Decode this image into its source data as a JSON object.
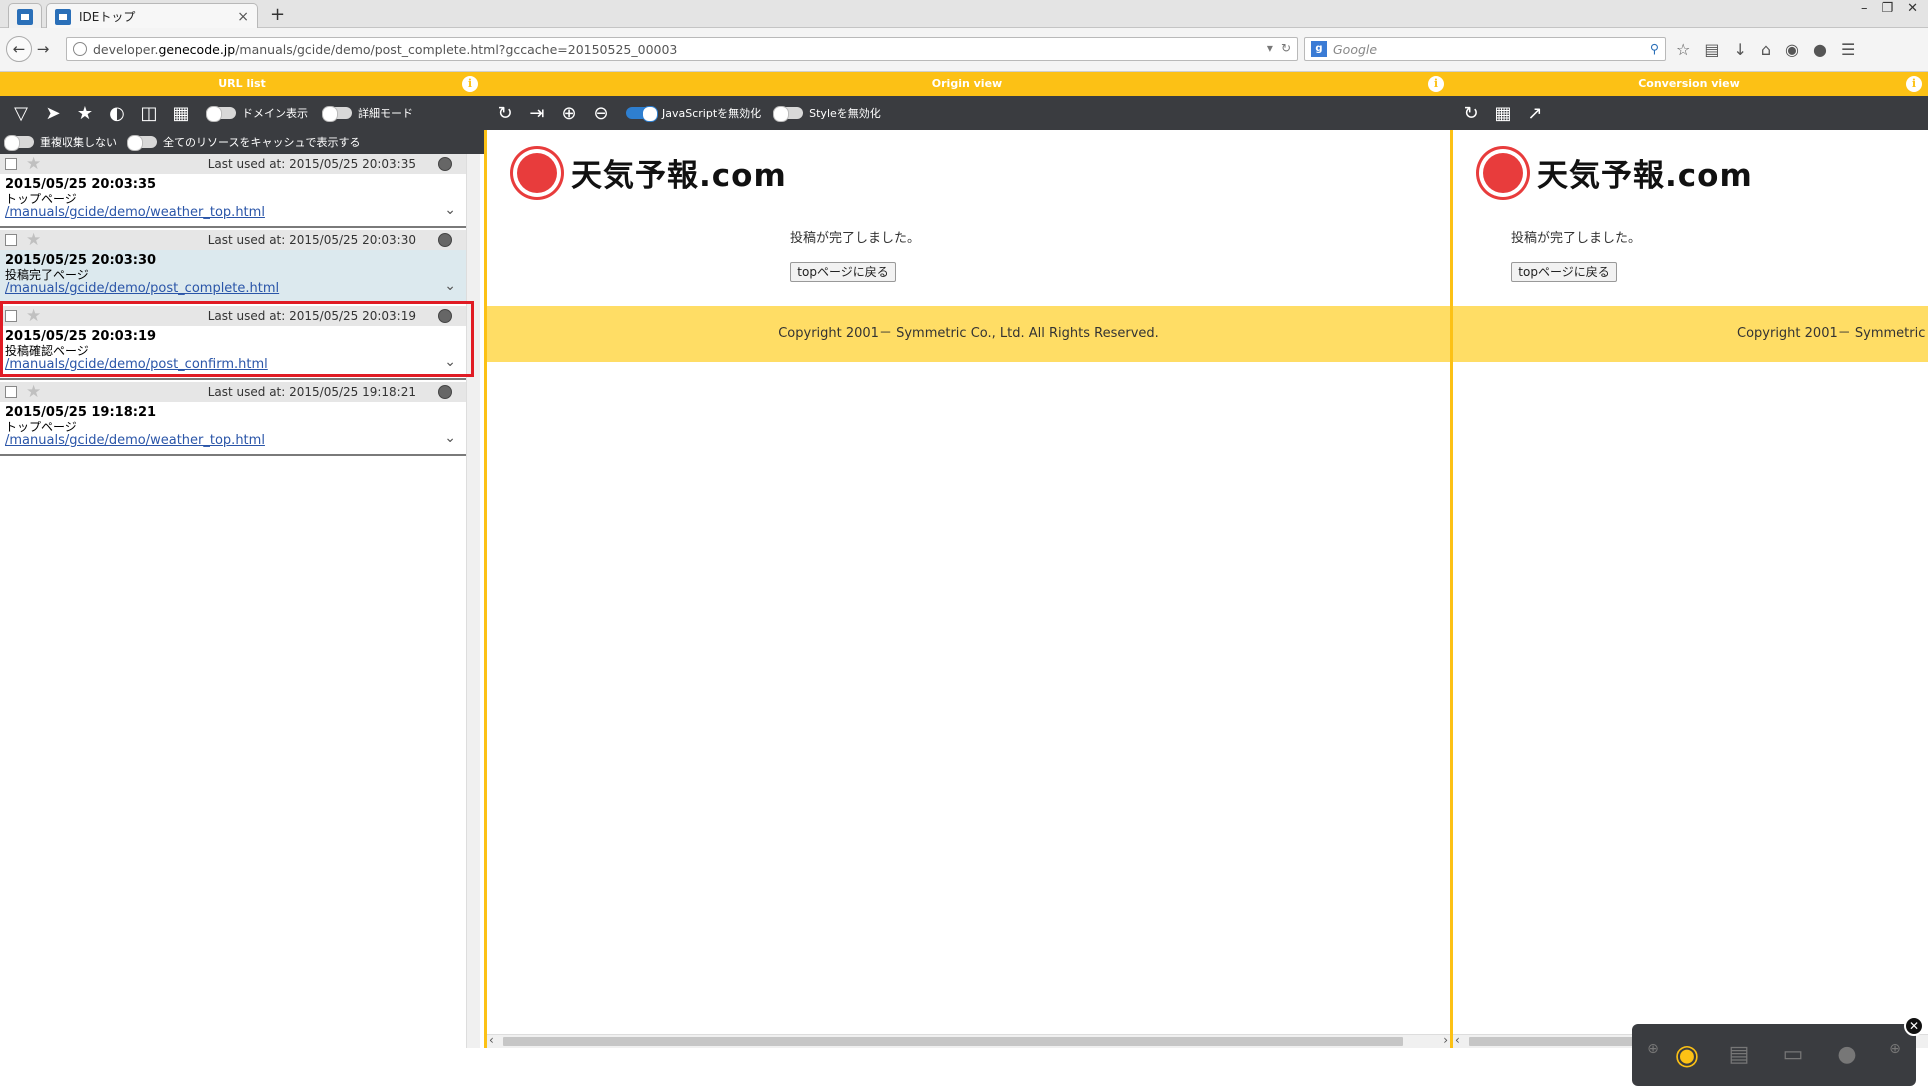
{
  "browser": {
    "tab_title": "IDEトップ",
    "url_domain": "developer.genecode.jp",
    "url_path": "/manuals/gcide/demo/post_complete.html?gccache=20150525_00003",
    "url_prefix": "developer.",
    "url_main": "genecode.jp",
    "search_placeholder": "Google",
    "newtab_label": "+",
    "close_tab": "×"
  },
  "panels": {
    "url_list": "URL list",
    "origin": "Origin view",
    "conversion": "Conversion view",
    "info": "i"
  },
  "left_toolbar": {
    "domain_toggle": "ドメイン表示",
    "detail_toggle": "詳細モード",
    "no_duplicate": "重複収集しない",
    "cache_all": "全てのリソースをキャッシュで表示する"
  },
  "origin_toolbar": {
    "js_disable": "JavaScriptを無効化",
    "style_disable": "Styleを無効化"
  },
  "entries": [
    {
      "last": "Last used at: 2015/05/25 20:03:35",
      "date": "2015/05/25 20:03:35",
      "title": "トップページ",
      "link": "/manuals/gcide/demo/weather_top.html"
    },
    {
      "last": "Last used at: 2015/05/25 20:03:30",
      "date": "2015/05/25 20:03:30",
      "title": "投稿完了ページ",
      "link": "/manuals/gcide/demo/post_complete.html"
    },
    {
      "last": "Last used at: 2015/05/25 20:03:19",
      "date": "2015/05/25 20:03:19",
      "title": "投稿確認ページ",
      "link": "/manuals/gcide/demo/post_confirm.html"
    },
    {
      "last": "Last used at: 2015/05/25 19:18:21",
      "date": "2015/05/25 19:18:21",
      "title": "トップページ",
      "link": "/manuals/gcide/demo/weather_top.html"
    }
  ],
  "site": {
    "logo_text": "天気予報.com",
    "message": "投稿が完了しました。",
    "button": "topページに戻る",
    "copyright": "Copyright 2001－ Symmetric Co., Ltd. All Rights Reserved.",
    "copyright_cut": "Copyright 2001－ Symmetric C"
  },
  "colors": {
    "accent": "#fcc115",
    "footer": "#ffdd65",
    "selection": "#e01b24",
    "toolbar": "#3a3c40"
  }
}
